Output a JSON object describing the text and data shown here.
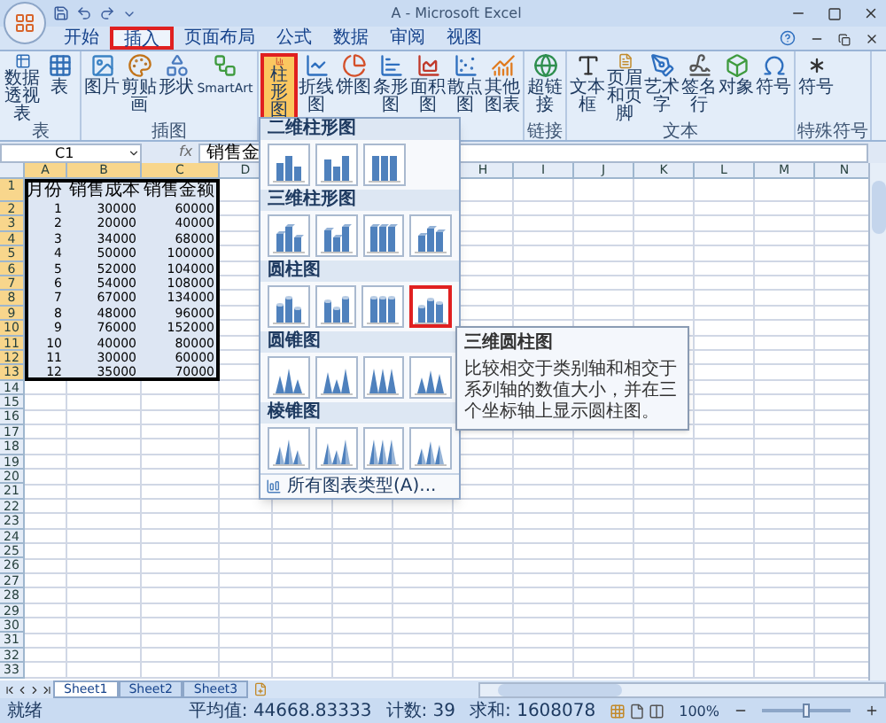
{
  "window": {
    "title": "A - Microsoft Excel"
  },
  "tabs": [
    {
      "label": "开始",
      "selected": false
    },
    {
      "label": "插入",
      "selected": true
    },
    {
      "label": "页面布局",
      "selected": false
    },
    {
      "label": "公式",
      "selected": false
    },
    {
      "label": "数据",
      "selected": false
    },
    {
      "label": "审阅",
      "selected": false
    },
    {
      "label": "视图",
      "selected": false
    }
  ],
  "ribbon": {
    "groups": [
      {
        "label": "表",
        "buttons": [
          {
            "label": "数据透视表",
            "selected": false
          },
          {
            "label": "表",
            "selected": false
          }
        ]
      },
      {
        "label": "插图",
        "buttons": [
          {
            "label": "图片",
            "selected": false
          },
          {
            "label": "剪贴画",
            "selected": false
          },
          {
            "label": "形状",
            "selected": false
          },
          {
            "label": "SmartArt",
            "selected": false
          }
        ]
      },
      {
        "buttons": [
          {
            "label": "柱形图",
            "selected": true
          },
          {
            "label": "折线图",
            "selected": false
          },
          {
            "label": "饼图",
            "selected": false
          },
          {
            "label": "条形图",
            "selected": false
          },
          {
            "label": "面积图",
            "selected": false
          },
          {
            "label": "散点图",
            "selected": false
          },
          {
            "label": "其他图表",
            "selected": false
          }
        ]
      },
      {
        "label": "链接",
        "buttons": [
          {
            "label": "超链接",
            "selected": false
          }
        ]
      },
      {
        "label": "文本",
        "buttons": [
          {
            "label": "文本框",
            "selected": false
          },
          {
            "label": "页眉和页脚",
            "selected": false
          },
          {
            "label": "艺术字",
            "selected": false
          },
          {
            "label": "签名行",
            "selected": false
          },
          {
            "label": "对象",
            "selected": false
          },
          {
            "label": "符号",
            "selected": false
          }
        ]
      },
      {
        "label": "特殊符号",
        "buttons": [
          {
            "label": "符号",
            "selected": false
          }
        ]
      }
    ]
  },
  "formula_bar": {
    "name_box": "C1",
    "function_label": "fx",
    "value": "销售金"
  },
  "sheet": {
    "columns_left": [
      {
        "label": "A",
        "selected": true
      },
      {
        "label": "B",
        "selected": true
      },
      {
        "label": "C",
        "selected": true
      },
      {
        "label": "D",
        "selected": false
      }
    ],
    "columns_right": [
      {
        "label": "H",
        "selected": false
      },
      {
        "label": "I",
        "selected": false
      },
      {
        "label": "J",
        "selected": false
      },
      {
        "label": "K",
        "selected": false
      },
      {
        "label": "L",
        "selected": false
      },
      {
        "label": "M",
        "selected": false
      },
      {
        "label": "N",
        "selected": false
      }
    ],
    "row_headers": [
      {
        "label": "1",
        "selected": true
      },
      {
        "label": "2",
        "selected": true
      },
      {
        "label": "3",
        "selected": true
      },
      {
        "label": "4",
        "selected": true
      },
      {
        "label": "5",
        "selected": true
      },
      {
        "label": "6",
        "selected": true
      },
      {
        "label": "7",
        "selected": true
      },
      {
        "label": "8",
        "selected": true
      },
      {
        "label": "9",
        "selected": true
      },
      {
        "label": "10",
        "selected": true
      },
      {
        "label": "11",
        "selected": true
      },
      {
        "label": "12",
        "selected": true
      },
      {
        "label": "13",
        "selected": true
      },
      {
        "label": "14",
        "selected": false
      },
      {
        "label": "15",
        "selected": false
      },
      {
        "label": "16",
        "selected": false
      },
      {
        "label": "17",
        "selected": false
      },
      {
        "label": "18",
        "selected": false
      },
      {
        "label": "19",
        "selected": false
      },
      {
        "label": "20",
        "selected": false
      },
      {
        "label": "21",
        "selected": false
      },
      {
        "label": "22",
        "selected": false
      },
      {
        "label": "23",
        "selected": false
      },
      {
        "label": "24",
        "selected": false
      },
      {
        "label": "25",
        "selected": false
      },
      {
        "label": "26",
        "selected": false
      },
      {
        "label": "27",
        "selected": false
      },
      {
        "label": "28",
        "selected": false
      },
      {
        "label": "29",
        "selected": false
      },
      {
        "label": "30",
        "selected": false
      },
      {
        "label": "31",
        "selected": false
      },
      {
        "label": "32",
        "selected": false
      },
      {
        "label": "33",
        "selected": false
      }
    ],
    "rows": [
      [
        "月份",
        "销售成本",
        "销售金额"
      ],
      [
        "1",
        "30000",
        "60000"
      ],
      [
        "2",
        "20000",
        "40000"
      ],
      [
        "3",
        "34000",
        "68000"
      ],
      [
        "4",
        "50000",
        "100000"
      ],
      [
        "5",
        "52000",
        "104000"
      ],
      [
        "6",
        "54000",
        "108000"
      ],
      [
        "7",
        "67000",
        "134000"
      ],
      [
        "8",
        "48000",
        "96000"
      ],
      [
        "9",
        "76000",
        "152000"
      ],
      [
        "10",
        "40000",
        "80000"
      ],
      [
        "11",
        "30000",
        "60000"
      ],
      [
        "12",
        "35000",
        "70000"
      ]
    ]
  },
  "chart_menu": {
    "sections": [
      {
        "title": "二维柱形图",
        "kind": "column",
        "items": [
          {
            "selected": false
          },
          {
            "selected": false
          },
          {
            "selected": false
          }
        ]
      },
      {
        "title": "三维柱形图",
        "kind": "column3d",
        "items": [
          {
            "selected": false
          },
          {
            "selected": false
          },
          {
            "selected": false
          },
          {
            "selected": false
          }
        ]
      },
      {
        "title": "圆柱图",
        "kind": "cylinder",
        "items": [
          {
            "selected": false
          },
          {
            "selected": false
          },
          {
            "selected": false
          },
          {
            "selected": true
          }
        ]
      },
      {
        "title": "圆锥图",
        "kind": "cone",
        "items": [
          {
            "selected": false
          },
          {
            "selected": false
          },
          {
            "selected": false
          },
          {
            "selected": false
          }
        ]
      },
      {
        "title": "棱锥图",
        "kind": "pyramid",
        "items": [
          {
            "selected": false
          },
          {
            "selected": false
          },
          {
            "selected": false
          },
          {
            "selected": false
          }
        ]
      }
    ],
    "footer": "所有图表类型(A)..."
  },
  "tooltip": {
    "title": "三维圆柱图",
    "text": "比较相交于类别轴和相交于系列轴的数值大小，并在三个坐标轴上显示圆柱图。"
  },
  "sheet_tabs": [
    {
      "label": "Sheet1",
      "selected": true
    },
    {
      "label": "Sheet2",
      "selected": false
    },
    {
      "label": "Sheet3",
      "selected": false
    }
  ],
  "status_bar": {
    "mode": "就绪",
    "average": "平均值: 44668.83333",
    "count": "计数: 39",
    "sum": "求和: 1608078",
    "zoom": "100%",
    "zoom_slider": {
      "level": 0.5
    }
  }
}
